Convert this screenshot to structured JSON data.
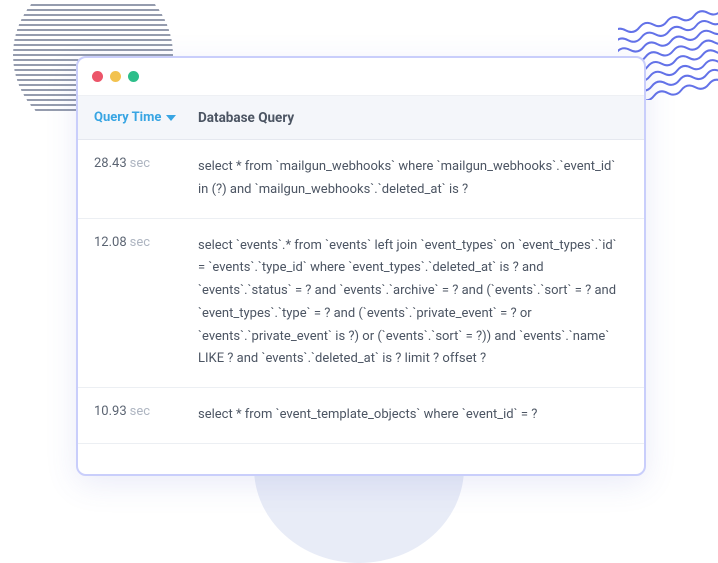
{
  "decorations": {
    "left_line_count": 24,
    "right_line_count": 8
  },
  "table": {
    "headers": {
      "time": "Query Time",
      "query": "Database Query"
    },
    "unit": "sec",
    "rows": [
      {
        "time": "28.43",
        "query": "select * from `mailgun_webhooks` where `mailgun_webhooks`.`event_id` in (?) and `mailgun_webhooks`.`deleted_at` is ?"
      },
      {
        "time": "12.08",
        "query": "select `events`.* from `events` left join `event_types` on `event_types`.`id` = `events`.`type_id` where `event_types`.`deleted_at` is ? and `events`.`status` = ? and `events`.`archive` = ? and (`events`.`sort` = ? and `event_types`.`type` = ? and (`events`.`private_event` = ? or `events`.`private_event` is ?) or (`events`.`sort` = ?)) and `events`.`name` LIKE ? and `events`.`deleted_at` is ? limit ? offset ?"
      },
      {
        "time": "10.93",
        "query": "select * from `event_template_objects` where `event_id` = ?"
      }
    ]
  }
}
